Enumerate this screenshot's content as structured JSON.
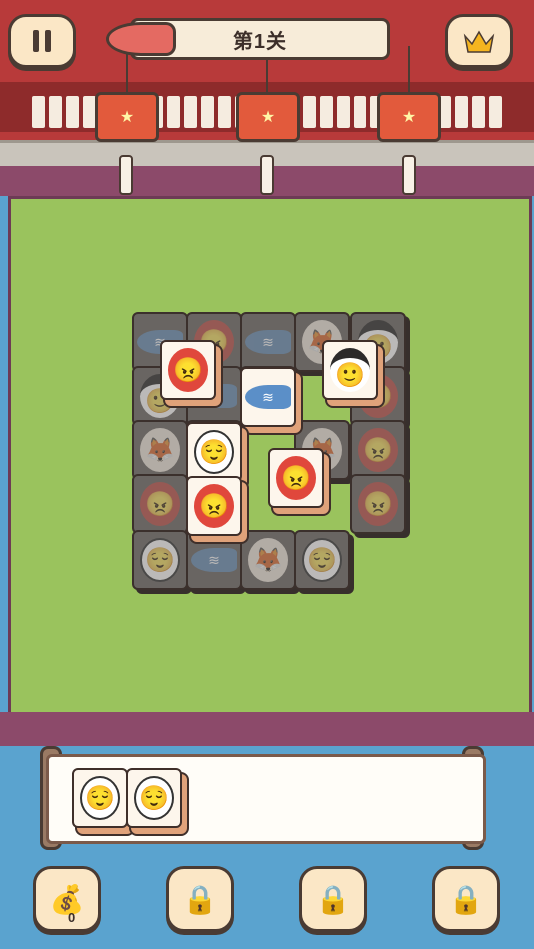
{
  "header": {
    "level_label": "第1关",
    "pause_icon": "pause-icon",
    "crown_icon": "crown-icon"
  },
  "lanterns": [
    {
      "icon": "star-icon",
      "glyph": "★"
    },
    {
      "icon": "star-icon",
      "glyph": "★"
    },
    {
      "icon": "star-icon",
      "glyph": "★"
    }
  ],
  "tiles": {
    "back": [
      {
        "type": "fish",
        "glyph": "≋"
      },
      {
        "type": "red",
        "glyph": "😠"
      },
      {
        "type": "fish",
        "glyph": "≋"
      },
      {
        "type": "fox",
        "glyph": "🦊"
      },
      {
        "type": "geisha",
        "glyph": "🙂"
      },
      {
        "type": "geisha",
        "glyph": "🙂"
      },
      {
        "type": "fish",
        "glyph": "≋"
      },
      {
        "type": "fox",
        "glyph": "🦊"
      },
      {
        "type": "red",
        "glyph": "😠"
      },
      {
        "type": "fox",
        "glyph": "🦊"
      },
      {
        "type": "geisha",
        "glyph": "🙂"
      },
      {
        "type": "fox",
        "glyph": "🦊"
      },
      {
        "type": "red",
        "glyph": "😠"
      },
      {
        "type": "red",
        "glyph": "😠"
      },
      {
        "type": "geisha",
        "glyph": "🙂"
      },
      {
        "type": "red",
        "glyph": "😠"
      },
      {
        "type": "white",
        "glyph": "😌"
      },
      {
        "type": "fish",
        "glyph": "≋"
      },
      {
        "type": "fox",
        "glyph": "🦊"
      },
      {
        "type": "white",
        "glyph": "😌"
      }
    ],
    "front": [
      {
        "type": "red",
        "glyph": "😠"
      },
      {
        "type": "fish",
        "glyph": "≋"
      },
      {
        "type": "geisha",
        "glyph": "🙂"
      },
      {
        "type": "white",
        "glyph": "😌"
      },
      {
        "type": "red",
        "glyph": "😠"
      },
      {
        "type": "red",
        "glyph": "😠"
      }
    ]
  },
  "tray": {
    "tiles": [
      {
        "type": "white",
        "glyph": "😌"
      },
      {
        "type": "white",
        "glyph": "😌"
      }
    ]
  },
  "bottom": {
    "money_icon": "money-bag-icon",
    "money_count": "0",
    "lock_icon": "lock-icon"
  },
  "colors": {
    "roof": "#b83a3a",
    "field": "#9ac35d",
    "water": "#5aa3cf",
    "button_bg": "#fbe7c6",
    "outline": "#4a3b33"
  }
}
